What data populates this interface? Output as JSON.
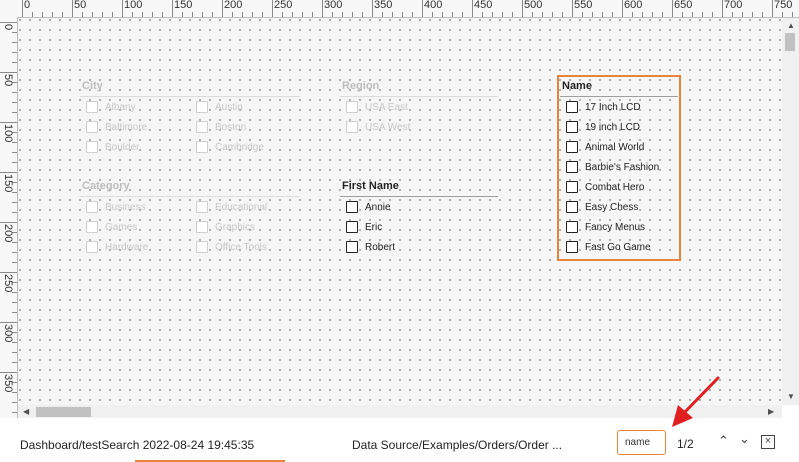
{
  "ruler": {
    "top_labels": [
      "0",
      "50",
      "100",
      "150",
      "200",
      "250",
      "300",
      "350",
      "400",
      "450",
      "500",
      "550",
      "600",
      "650",
      "700",
      "750"
    ],
    "left_labels": [
      "0",
      "50",
      "100",
      "150",
      "200",
      "250",
      "300",
      "350"
    ]
  },
  "widgets": {
    "city": {
      "title": "City",
      "col1": [
        "Albany",
        "Baltimore",
        "Boulder"
      ],
      "col2": [
        "Austin",
        "Boston",
        "Cambridge"
      ]
    },
    "region": {
      "title": "Region",
      "col1": [
        "USA East",
        "USA West"
      ]
    },
    "category": {
      "title": "Category",
      "col1": [
        "Business",
        "Games",
        "Hardware"
      ],
      "col2": [
        "Educational",
        "Graphics",
        "Office Tools"
      ]
    },
    "first_name": {
      "title": "First Name",
      "items": [
        "Annie",
        "Eric",
        "Robert"
      ]
    },
    "name": {
      "title": "Name",
      "items": [
        "17 Inch LCD",
        "19 inch LCD",
        "Animal World",
        "Barbie's Fashion",
        "Combat Hero",
        "Easy Chess",
        "Fancy Menus",
        "Fast Go Game"
      ]
    }
  },
  "statusbar": {
    "path_left": "Dashboard/testSearch 2022-08-24 19:45:35",
    "path_right": "Data Source/Examples/Orders/Order ...",
    "search_value": "name",
    "match_count": "1/2"
  },
  "colors": {
    "accent": "#e8843c",
    "annotation_arrow": "#e02020"
  },
  "icons": {
    "prev": "chevron-up-icon",
    "next": "chevron-down-icon",
    "close": "close-box-icon"
  }
}
